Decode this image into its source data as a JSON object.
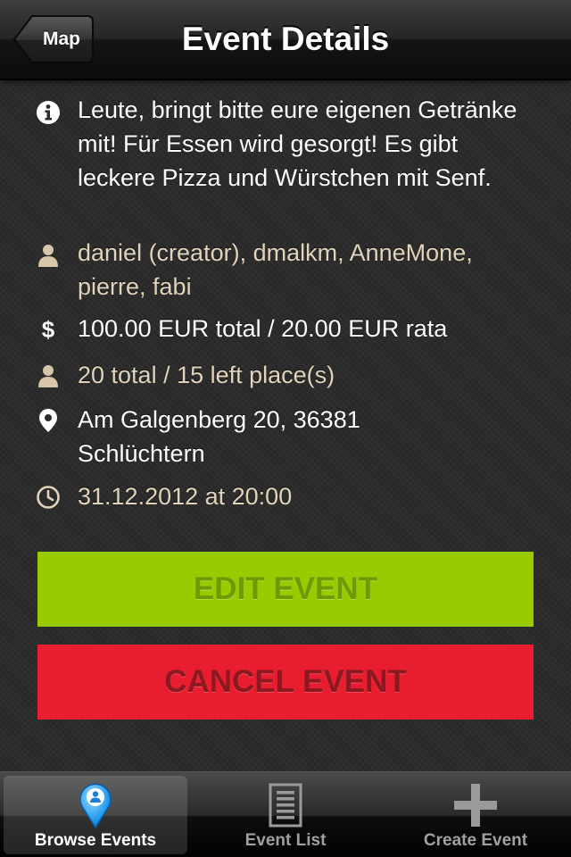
{
  "navbar": {
    "back_label": "Map",
    "title": "Event Details"
  },
  "details": {
    "description": "Leute, bringt bitte eure eigenen Getränke mit! Für Essen wird gesorgt! Es gibt leckere Pizza und Würstchen mit Senf.",
    "participants": "daniel (creator), dmalkm, AnneMone, pierre, fabi",
    "cost": "100.00 EUR total / 20.00 EUR rata",
    "places": "20 total / 15 left place(s)",
    "address": "Am Galgenberg 20, 36381 Schlüchtern",
    "datetime": "31.12.2012 at 20:00",
    "icons": [
      "info-icon",
      "person-icon",
      "dollar-icon",
      "person-icon",
      "location-pin-icon",
      "clock-icon"
    ]
  },
  "actions": {
    "edit_label": "EDIT EVENT",
    "cancel_label": "CANCEL EVENT"
  },
  "tabbar": {
    "tabs": [
      {
        "label": "Browse Events",
        "icon": "map-pin-person-icon",
        "active": true
      },
      {
        "label": "Event List",
        "icon": "list-icon",
        "active": false
      },
      {
        "label": "Create Event",
        "icon": "plus-icon",
        "active": false
      }
    ]
  },
  "colors": {
    "edit_button": "#99cc00",
    "cancel_button": "#e81e30",
    "text_white": "#ffffff",
    "text_tan": "#e2d3bb",
    "background": "#2b2b2b"
  }
}
